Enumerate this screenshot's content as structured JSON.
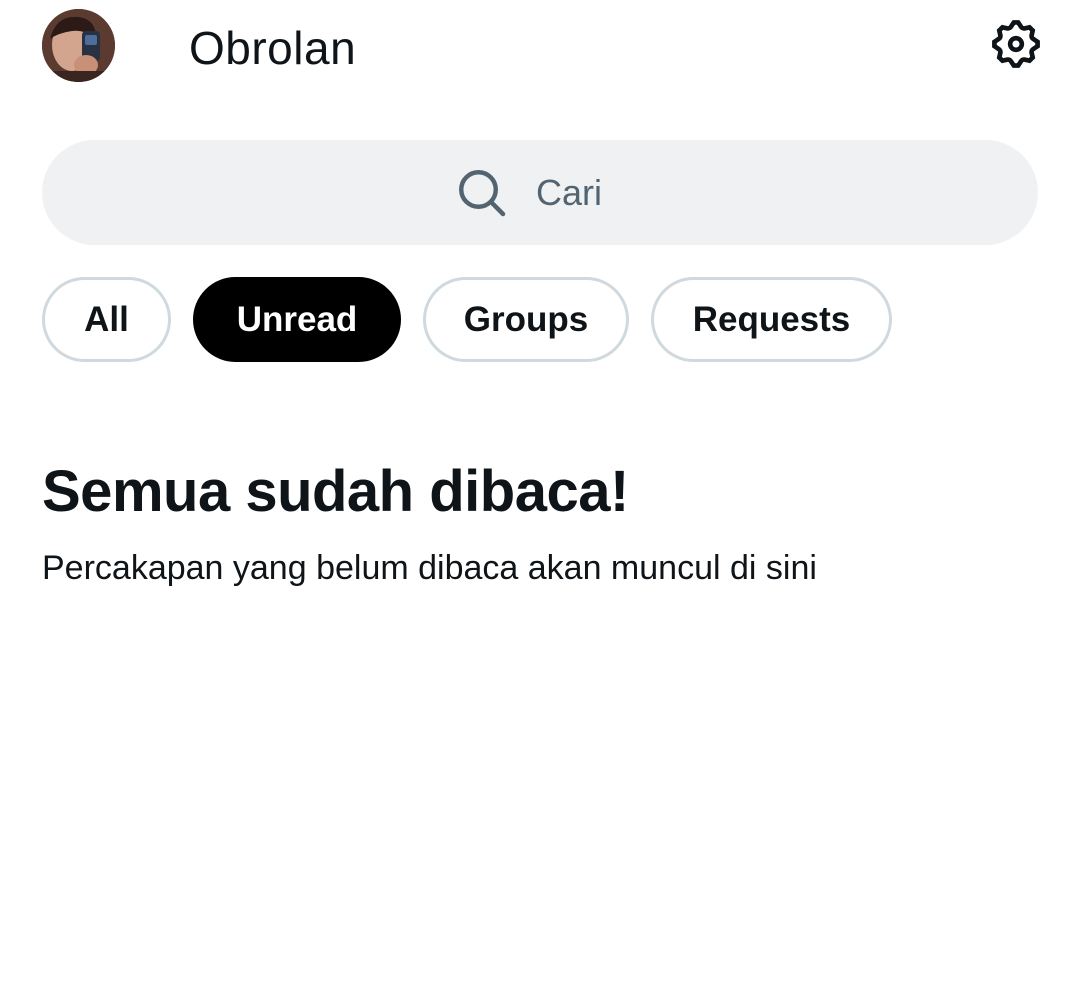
{
  "header": {
    "title": "Obrolan",
    "avatar_icon": "profile-photo",
    "settings_icon": "gear-icon"
  },
  "search": {
    "placeholder": "Cari",
    "icon": "search-icon"
  },
  "tabs": [
    {
      "label": "All",
      "active": false
    },
    {
      "label": "Unread",
      "active": true
    },
    {
      "label": "Groups",
      "active": false
    },
    {
      "label": "Requests",
      "active": false
    }
  ],
  "empty_state": {
    "title": "Semua sudah dibaca!",
    "subtitle": "Percakapan yang belum dibaca akan muncul di sini"
  },
  "colors": {
    "text_primary": "#0f1419",
    "text_secondary": "#536471",
    "search_bg": "#eff1f3",
    "tab_border": "#cfd9de",
    "tab_active_bg": "#000000"
  }
}
